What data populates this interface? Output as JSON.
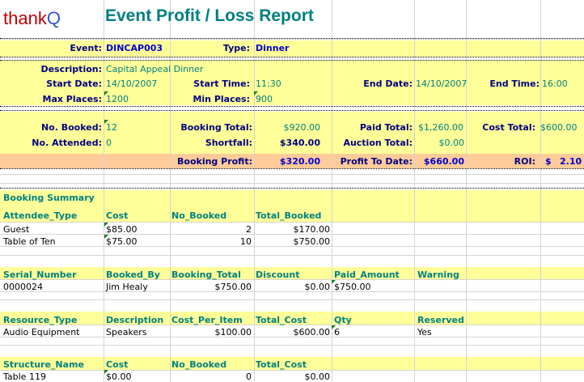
{
  "header": {
    "logo_text_1": "thank",
    "logo_text_2": "Q",
    "title": "Event Profit / Loss Report"
  },
  "event": {
    "event_label": "Event:",
    "event_value": "DINCAP003",
    "type_label": "Type:",
    "type_value": "Dinner"
  },
  "details": {
    "description_label": "Description:",
    "description_value": "Capital Appeal Dinner",
    "start_date_label": "Start Date:",
    "start_date_value": "14/10/2007",
    "start_time_label": "Start Time:",
    "start_time_value": "11:30",
    "end_date_label": "End Date:",
    "end_date_value": "14/10/2007",
    "end_time_label": "End Time:",
    "end_time_value": "16:00",
    "max_places_label": "Max Places:",
    "max_places_value": "1200",
    "min_places_label": "Min Places:",
    "min_places_value": "900"
  },
  "financials": {
    "no_booked_label": "No. Booked:",
    "no_booked_value": "12",
    "booking_total_label": "Booking Total:",
    "booking_total_value": "$920.00",
    "paid_total_label": "Paid Total:",
    "paid_total_value": "$1,260.00",
    "cost_total_label": "Cost Total:",
    "cost_total_value": "$600.00",
    "no_attended_label": "No. Attended:",
    "no_attended_value": "0",
    "shortfall_label": "Shortfall:",
    "shortfall_value": "$340.00",
    "auction_total_label": "Auction Total:",
    "auction_total_value": "$0.00"
  },
  "profit": {
    "booking_profit_label": "Booking Profit:",
    "booking_profit_value": "$320.00",
    "profit_to_date_label": "Profit To Date:",
    "profit_to_date_value": "$660.00",
    "roi_label": "ROI:",
    "roi_currency": "$",
    "roi_value": "2.10"
  },
  "booking_summary": {
    "title": "Booking Summary",
    "headers": [
      "Attendee_Type",
      "Cost",
      "No_Booked",
      "Total_Booked"
    ],
    "rows": [
      [
        "Guest",
        "$85.00",
        "2",
        "$170.00"
      ],
      [
        "Table of Ten",
        "$75.00",
        "10",
        "$750.00"
      ]
    ]
  },
  "payments": {
    "headers": [
      "Serial_Number",
      "Booked_By",
      "Booking_Total",
      "Discount",
      "Paid_Amount",
      "Warning"
    ],
    "rows": [
      [
        "0000024",
        "Jim Healy",
        "$750.00",
        "$0.00",
        "$750.00",
        ""
      ]
    ]
  },
  "resources": {
    "headers": [
      "Resource_Type",
      "Description",
      "Cost_Per_Item",
      "Total_Cost",
      "Qty",
      "Reserved"
    ],
    "rows": [
      [
        "Audio Equipment",
        "Speakers",
        "$100.00",
        "$600.00",
        "6",
        "Yes"
      ]
    ]
  },
  "structures": {
    "headers": [
      "Structure_Name",
      "Cost",
      "No_Booked",
      "Total_Cost"
    ],
    "rows": [
      [
        "Table 119",
        "$0.00",
        "0",
        "$0.00"
      ]
    ]
  },
  "colors": {
    "accent_teal": "#008080",
    "navy": "#000080",
    "band_yellow": "#ffff99",
    "band_peach": "#ffcc99",
    "logo_red": "#c00000",
    "logo_blue": "#3355cc"
  }
}
